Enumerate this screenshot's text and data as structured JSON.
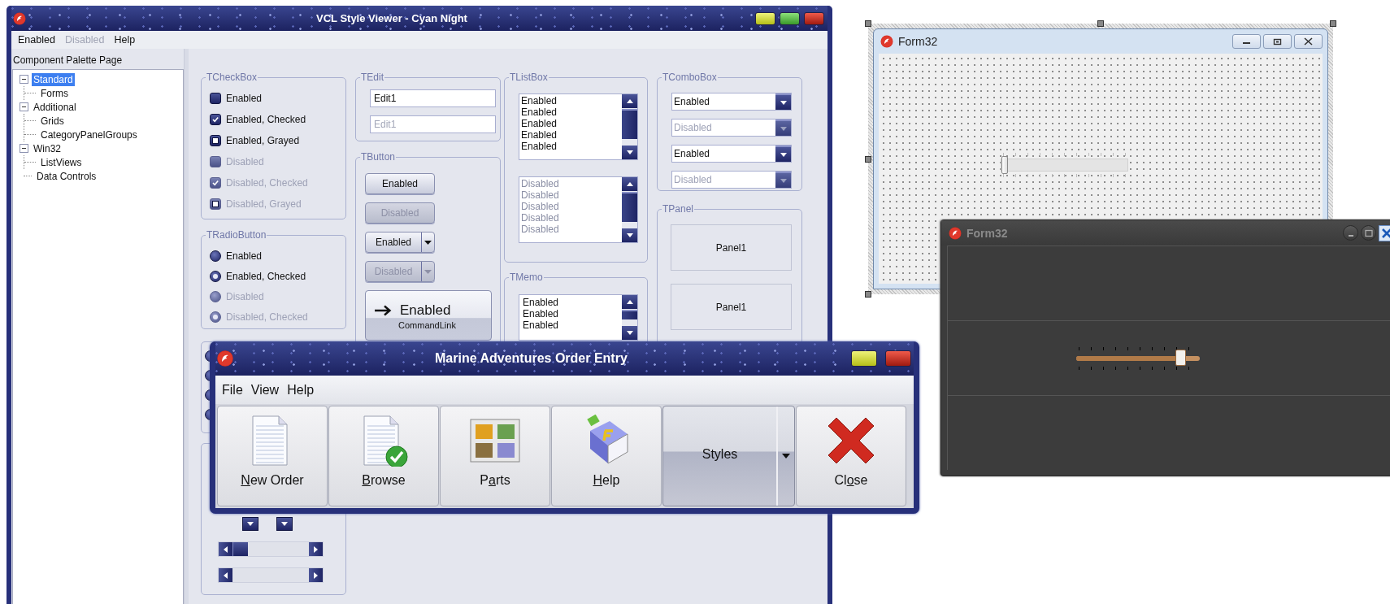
{
  "style_viewer": {
    "title": "VCL Style Viewer - Cyan Night",
    "menu": [
      {
        "label": "Enabled",
        "disabled": false
      },
      {
        "label": "Disabled",
        "disabled": true
      },
      {
        "label": "Help",
        "disabled": false
      }
    ],
    "palette_label": "Component Palette Page",
    "tree": [
      {
        "label": "Standard",
        "selected": true,
        "expanded": true,
        "children": [
          {
            "label": "Forms",
            "selected": false
          }
        ]
      },
      {
        "label": "Additional",
        "selected": false,
        "expanded": true,
        "children": [
          {
            "label": "Grids",
            "selected": false
          },
          {
            "label": "CategoryPanelGroups",
            "selected": false
          }
        ]
      },
      {
        "label": "Win32",
        "selected": false,
        "expanded": true,
        "children": [
          {
            "label": "ListViews",
            "selected": false
          }
        ]
      },
      {
        "label": "Data Controls",
        "selected": false
      }
    ],
    "checkboxes": {
      "title": "TCheckBox",
      "items": [
        {
          "label": "Enabled",
          "checked": false,
          "grayed": false,
          "disabled": false
        },
        {
          "label": "Enabled, Checked",
          "checked": true,
          "grayed": false,
          "disabled": false
        },
        {
          "label": "Enabled, Grayed",
          "checked": false,
          "grayed": true,
          "disabled": false
        },
        {
          "label": "Disabled",
          "checked": false,
          "grayed": false,
          "disabled": true
        },
        {
          "label": "Disabled, Checked",
          "checked": true,
          "grayed": false,
          "disabled": true
        },
        {
          "label": "Disabled, Grayed",
          "checked": false,
          "grayed": true,
          "disabled": true
        }
      ]
    },
    "radios": {
      "title": "TRadioButton",
      "items": [
        {
          "label": "Enabled",
          "checked": false,
          "disabled": false
        },
        {
          "label": "Enabled, Checked",
          "checked": true,
          "disabled": false
        },
        {
          "label": "Disabled",
          "checked": false,
          "disabled": true
        },
        {
          "label": "Disabled, Checked",
          "checked": true,
          "disabled": true
        }
      ]
    },
    "edits": {
      "title": "TEdit",
      "items": [
        {
          "value": "Edit1",
          "disabled": false
        },
        {
          "value": "Edit1",
          "disabled": true
        }
      ]
    },
    "buttons": {
      "title": "TButton",
      "items": [
        {
          "kind": "push",
          "label": "Enabled",
          "disabled": false
        },
        {
          "kind": "push",
          "label": "Disabled",
          "disabled": true
        },
        {
          "kind": "split",
          "label": "Enabled",
          "disabled": false
        },
        {
          "kind": "split",
          "label": "Disabled",
          "disabled": true
        },
        {
          "kind": "commandlink",
          "label": "Enabled",
          "note": "CommandLink",
          "disabled": false
        }
      ]
    },
    "listboxes": {
      "title": "TListBox",
      "items": [
        {
          "disabled": false,
          "rows": [
            "Enabled",
            "Enabled",
            "Enabled",
            "Enabled",
            "Enabled"
          ]
        },
        {
          "disabled": true,
          "rows": [
            "Disabled",
            "Disabled",
            "Disabled",
            "Disabled",
            "Disabled"
          ]
        }
      ]
    },
    "memo": {
      "title": "TMemo",
      "lines": [
        "Enabled",
        "Enabled",
        "Enabled"
      ]
    },
    "comboboxes": {
      "title": "TComboBox",
      "items": [
        {
          "value": "Enabled",
          "disabled": false
        },
        {
          "value": "Disabled",
          "disabled": true
        },
        {
          "value": "Enabled",
          "disabled": false
        },
        {
          "value": "Disabled",
          "disabled": true
        }
      ]
    },
    "panels": {
      "title": "TPanel",
      "items": [
        "Panel1",
        "Panel1"
      ]
    }
  },
  "order_entry": {
    "title": "Marine Adventures Order Entry",
    "menu": [
      "File",
      "View",
      "Help"
    ],
    "toolbar": [
      {
        "kind": "document",
        "key": "N",
        "after": "ew Order"
      },
      {
        "kind": "document-check",
        "key": "B",
        "after": "rowse"
      },
      {
        "kind": "gallery",
        "before": "P",
        "key": "a",
        "after": "rts"
      },
      {
        "kind": "book",
        "key": "H",
        "after": "elp"
      },
      {
        "kind": "dropdown",
        "before": "Styles"
      },
      {
        "kind": "cross",
        "before": "Cl",
        "key": "o",
        "after": "se"
      }
    ]
  },
  "designer_form": {
    "title": "Form32",
    "trackbar": {
      "level": 0
    }
  },
  "dark_form": {
    "title": "Form32",
    "trackbar": {
      "level": 0.89
    }
  }
}
